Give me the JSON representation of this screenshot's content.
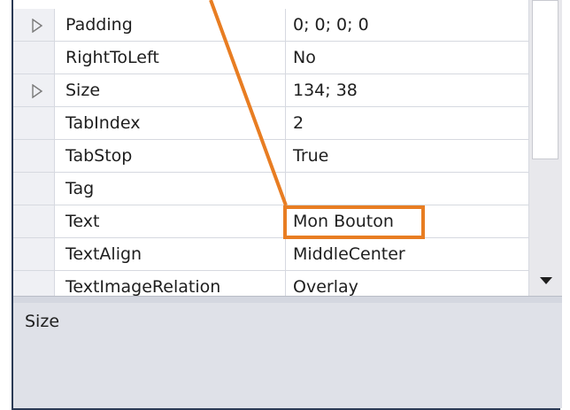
{
  "properties": [
    {
      "name": "Padding",
      "value": "0; 0; 0; 0",
      "expandable": true
    },
    {
      "name": "RightToLeft",
      "value": "No",
      "expandable": false
    },
    {
      "name": "Size",
      "value": "134; 38",
      "expandable": true
    },
    {
      "name": "TabIndex",
      "value": "2",
      "expandable": false
    },
    {
      "name": "TabStop",
      "value": "True",
      "expandable": false
    },
    {
      "name": "Tag",
      "value": "",
      "expandable": false
    },
    {
      "name": "Text",
      "value": "Mon Bouton",
      "expandable": false
    },
    {
      "name": "TextAlign",
      "value": "MiddleCenter",
      "expandable": false
    },
    {
      "name": "TextImageRelation",
      "value": "Overlay",
      "expandable": false
    }
  ],
  "description": {
    "title": "Size"
  },
  "icons": {
    "expander": "expand-triangle-icon",
    "scroll_down": "scroll-down-arrow-icon"
  },
  "colors": {
    "annotation": "#e87d22",
    "gutter": "#eff0f4",
    "description_bg": "#dfe1e8",
    "frame": "#2b3a55"
  }
}
